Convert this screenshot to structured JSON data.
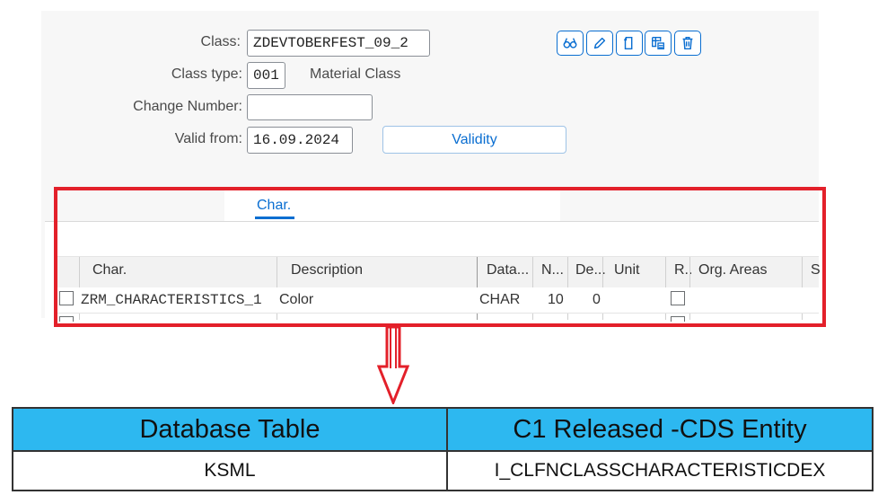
{
  "form": {
    "class_label": "Class:",
    "class_value": "ZDEVTOBERFEST_09_2",
    "class_type_label": "Class type:",
    "class_type_value": "001",
    "class_type_text": "Material Class",
    "change_number_label": "Change Number:",
    "change_number_value": "",
    "valid_from_label": "Valid from:",
    "valid_from_value": "16.09.2024",
    "validity_button": "Validity"
  },
  "toolbar_icons": [
    "display-glasses-icon",
    "edit-pencil-icon",
    "copy-document-icon",
    "table-settings-icon",
    "delete-trash-icon"
  ],
  "tabs": [
    {
      "label": "Char."
    }
  ],
  "grid": {
    "headers": [
      "Char.",
      "Description",
      "Data...",
      "N...",
      "De...",
      "Unit",
      "R..",
      "Org. Areas",
      "S"
    ],
    "rows": [
      {
        "char": "ZRM_CHARACTERISTICS_1",
        "description": "Color",
        "data_type": "CHAR",
        "number": "10",
        "decimals": "0",
        "unit": "",
        "restricted": false,
        "org_areas": ""
      }
    ]
  },
  "reference_table": {
    "headers": [
      "Database Table",
      "C1 Released -CDS Entity"
    ],
    "rows": [
      [
        "KSML",
        "I_CLFNCLASSCHARACTERISTICDEX"
      ]
    ]
  },
  "colors": {
    "accent": "#0a6ed1",
    "highlight": "#e3202a",
    "table_header": "#2db8f0"
  }
}
